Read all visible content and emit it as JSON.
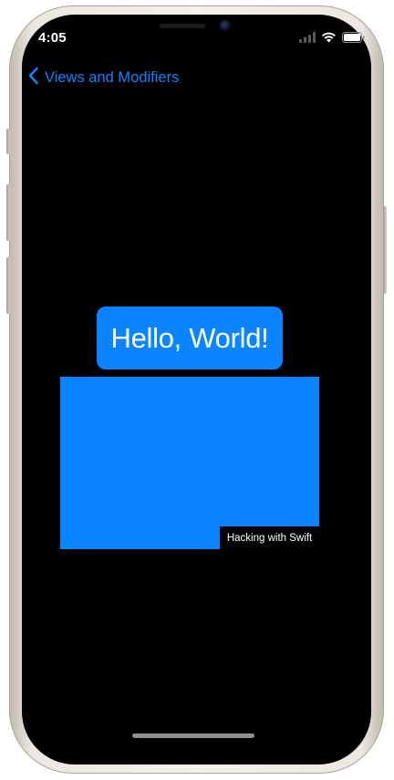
{
  "status_bar": {
    "time": "4:05",
    "icons": [
      "cellular-signal-icon",
      "wifi-icon",
      "battery-icon"
    ]
  },
  "navigation": {
    "back_icon": "chevron-left-icon",
    "back_label": "Views and Modifiers"
  },
  "content": {
    "hello_text": "Hello, World!",
    "caption_text": "Hacking with Swift"
  },
  "colors": {
    "accent": "#0a84ff",
    "background": "#000000",
    "text": "#ffffff"
  }
}
